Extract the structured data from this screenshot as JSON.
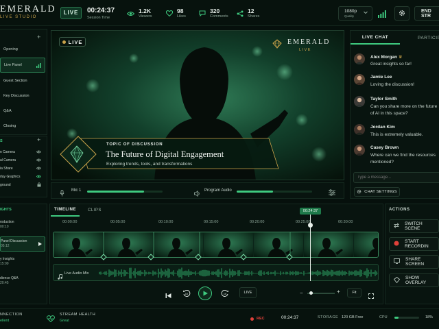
{
  "brand": {
    "name": "EMERALD",
    "sub": "LIVE STUDIO"
  },
  "header": {
    "live_label": "LIVE",
    "session_time": "00:24:37",
    "session_label": "Session Time",
    "viewers": "1.2K",
    "viewers_label": "Viewers",
    "likes": "98",
    "likes_label": "Likes",
    "comments": "320",
    "comments_label": "Comments",
    "shares": "12",
    "shares_label": "Shares",
    "quality": "1080p",
    "quality_label": "Quality",
    "end_label": "END STR"
  },
  "sidebar": {
    "segments": [
      {
        "label": "Opening"
      },
      {
        "label": "Live Panel"
      },
      {
        "label": "Guest Section"
      },
      {
        "label": "Key Discussion"
      },
      {
        "label": "Q&A"
      },
      {
        "label": "Closing"
      }
    ],
    "sources_header": "S",
    "sources": [
      "n Camera",
      "al Camera",
      "ia Share",
      "rlay Graphics",
      "ground"
    ],
    "highlights_header": "IGHTS",
    "highlights": [
      {
        "title": "roduction",
        "time": "00:10"
      },
      {
        "title": "Panel Discussion",
        "time": "05:12"
      },
      {
        "title": "y Insights",
        "time": "15:09"
      },
      {
        "title": "dience Q&A",
        "time": "20:45"
      }
    ]
  },
  "preview": {
    "live_label": "LIVE",
    "logo_name": "EMERALD",
    "logo_sub": "LIVE",
    "topic_label": "TOPIC OF DISCUSSION",
    "topic_title": "The Future of Digital Engagement",
    "topic_subtitle": "Exploring trends, tools, and transformations"
  },
  "audio": {
    "mic_label": "Mic 1",
    "program_label": "Program Audio"
  },
  "chat": {
    "tab_live": "LIVE CHAT",
    "tab_participants": "PARTICIPA",
    "messages": [
      {
        "name": "Alex Morgan",
        "text": "Great insights so far!"
      },
      {
        "name": "Jamie Lee",
        "text": "Loving the discussion!"
      },
      {
        "name": "Taylor Smith",
        "text": "Can you share more on the future of AI in this space?"
      },
      {
        "name": "Jordan Kim",
        "text": "This is extremely valuable."
      },
      {
        "name": "Casey Brown",
        "text": "Where can we find the resources mentioned?"
      }
    ],
    "placeholder": "Type a message...",
    "settings_label": "CHAT SETTINGS"
  },
  "timeline": {
    "tab_timeline": "TIMELINE",
    "tab_clips": "CLIPS",
    "playhead": "00:24:37",
    "ticks": [
      "00:00:00",
      "00:05:00",
      "00:10:00",
      "00:15:00",
      "00:20:00",
      "00:25:00",
      "00:30:00"
    ],
    "audio_track": "Live Audio Mix",
    "live_btn": "LIVE",
    "fit_btn": "Fit"
  },
  "actions": {
    "header": "ACTIONS",
    "items": [
      {
        "label": "SWITCH SCENE"
      },
      {
        "label": "START RECORDIN"
      },
      {
        "label": "SHARE SCREEN"
      },
      {
        "label": "SHOW OVERLAY"
      }
    ]
  },
  "status": {
    "connection_label": "NNECTION",
    "connection_value": "ellent",
    "health_label": "STREAM HEALTH",
    "health_value": "Great",
    "rec_label": "REC",
    "rec_time": "00:24:37",
    "storage_label": "STORAGE",
    "storage_value": "120 GB Free",
    "cpu_label": "CPU",
    "cpu_value": "18%",
    "cpu_fraction": 0.18
  },
  "colors": {
    "accent": "#3fcb80",
    "gold": "#c9a24a",
    "record": "#e0413a",
    "bg": "#06100c"
  }
}
